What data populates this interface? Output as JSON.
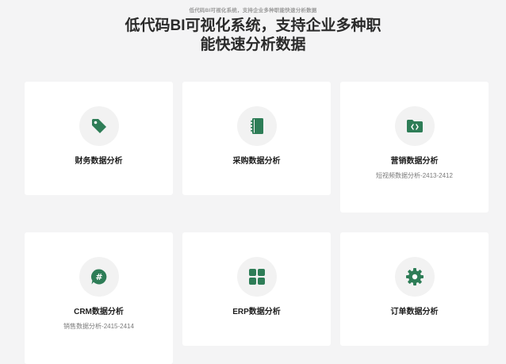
{
  "page": {
    "eyebrow": "低代码BI可视化系统，支持企业多种职能快速分析数据",
    "headline_line1": "低代码BI可视化系统，支持企业多种职",
    "headline_line2": "能快速分析数据"
  },
  "colors": {
    "accent": "#2e7d57",
    "background": "#f4f4f5",
    "card": "#ffffff",
    "icon_bg": "#f2f2f2"
  },
  "cards": [
    {
      "title": "财务数据分析",
      "subtitle": "",
      "icon": "tag-icon"
    },
    {
      "title": "采购数据分析",
      "subtitle": "",
      "icon": "notebook-icon"
    },
    {
      "title": "营销数据分析",
      "subtitle": "短视频数据分析-2413-2412",
      "icon": "folder-code-icon"
    },
    {
      "title": "CRM数据分析",
      "subtitle": "销售数据分析-2415-2414",
      "icon": "hashtag-chat-icon"
    },
    {
      "title": "ERP数据分析",
      "subtitle": "",
      "icon": "grid-icon"
    },
    {
      "title": "订单数据分析",
      "subtitle": "",
      "icon": "gear-icon"
    }
  ]
}
